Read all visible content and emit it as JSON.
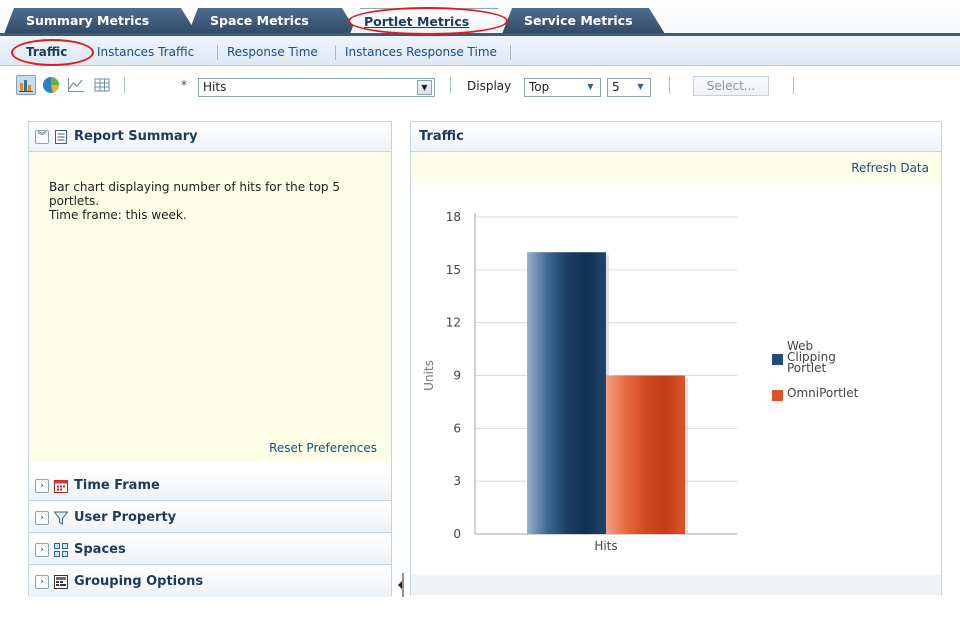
{
  "tabs": [
    {
      "label": "Summary Metrics"
    },
    {
      "label": "Space Metrics"
    },
    {
      "label": "Portlet Metrics"
    },
    {
      "label": "Service Metrics"
    }
  ],
  "subnav": {
    "items": [
      {
        "label": "Traffic"
      },
      {
        "label": "Instances Traffic"
      },
      {
        "label": "Response Time"
      },
      {
        "label": "Instances Response Time"
      }
    ]
  },
  "toolbar": {
    "metric_star": "*",
    "metric_value": "Hits",
    "display_label": "Display",
    "display_value": "Top",
    "count_value": "5",
    "select_button": "Select..."
  },
  "left_panel": {
    "report_summary": {
      "title": "Report Summary",
      "text_line1": "Bar chart displaying number of hits for the top 5 portlets.",
      "text_line2": "Time frame: this week.",
      "reset_link": "Reset Preferences"
    },
    "sections": [
      {
        "title": "Time Frame"
      },
      {
        "title": "User Property"
      },
      {
        "title": "Spaces"
      },
      {
        "title": "Grouping Options"
      }
    ]
  },
  "right_panel": {
    "title": "Traffic",
    "refresh_link": "Refresh Data"
  },
  "colors": {
    "tab_active_highlight": "#e41a1a",
    "series_web_clipping": "#1f4e79",
    "series_omniportlet": "#e0532a",
    "link": "#1f4d7e"
  },
  "chart_data": {
    "type": "bar",
    "categories": [
      "Hits"
    ],
    "series": [
      {
        "name": "Web Clipping Portlet",
        "values": [
          16
        ]
      },
      {
        "name": "OmniPortlet",
        "values": [
          9
        ]
      }
    ],
    "legend_labels": [
      [
        "Web",
        "Clipping",
        "Portlet"
      ],
      [
        "OmniPortlet"
      ]
    ],
    "ylabel": "Units",
    "xlabel": "",
    "ylim": [
      0,
      18
    ],
    "yticks": [
      "0",
      "3",
      "6",
      "9",
      "12",
      "15",
      "18"
    ],
    "grid": true,
    "legend_position": "right"
  }
}
